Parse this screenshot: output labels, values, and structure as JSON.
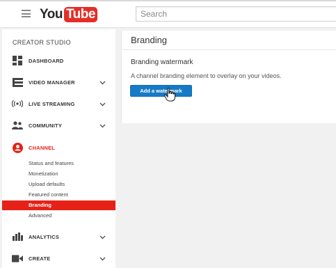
{
  "header": {
    "logo": {
      "you": "You",
      "tube": "Tube"
    },
    "search": {
      "placeholder": "Search"
    }
  },
  "sidebar": {
    "title": "CREATOR STUDIO",
    "items": [
      {
        "label": "DASHBOARD",
        "icon": "dashboard-icon",
        "expandable": false
      },
      {
        "label": "VIDEO MANAGER",
        "icon": "video-manager-icon",
        "expandable": true
      },
      {
        "label": "LIVE STREAMING",
        "icon": "live-streaming-icon",
        "expandable": true
      },
      {
        "label": "COMMUNITY",
        "icon": "community-icon",
        "expandable": true
      },
      {
        "label": "CHANNEL",
        "icon": "channel-icon",
        "expandable": false,
        "active": true
      },
      {
        "label": "ANALYTICS",
        "icon": "analytics-icon",
        "expandable": true
      },
      {
        "label": "CREATE",
        "icon": "create-icon",
        "expandable": true
      }
    ],
    "channel_subitems": [
      {
        "label": "Status and features"
      },
      {
        "label": "Monetization"
      },
      {
        "label": "Upload defaults"
      },
      {
        "label": "Featured content"
      },
      {
        "label": "Branding",
        "selected": true
      },
      {
        "label": "Advanced"
      }
    ]
  },
  "main": {
    "title": "Branding",
    "section_title": "Branding watermark",
    "section_description": "A channel branding element to overlay on your videos.",
    "add_button_label": "Add a watermark"
  },
  "colors": {
    "accent_red": "#e62117",
    "button_blue": "#167ac6",
    "logo_red": "#e52d27"
  }
}
